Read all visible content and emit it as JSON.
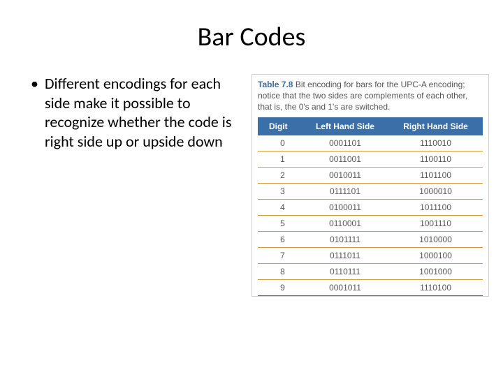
{
  "title": "Bar Codes",
  "bullet": "Different encodings for each side make it possible to recognize whether the code is right side up or upside down",
  "caption_label": "Table 7.8",
  "caption_text": "Bit encoding for bars for the UPC-A encoding; notice that the two sides are complements of each other, that is, the 0's and 1's are switched.",
  "chart_data": {
    "type": "table",
    "columns": [
      "Digit",
      "Left Hand Side",
      "Right Hand Side"
    ],
    "rows": [
      {
        "digit": "0",
        "left": "0001101",
        "right": "1110010"
      },
      {
        "digit": "1",
        "left": "0011001",
        "right": "1100110"
      },
      {
        "digit": "2",
        "left": "0010011",
        "right": "1101100"
      },
      {
        "digit": "3",
        "left": "0111101",
        "right": "1000010"
      },
      {
        "digit": "4",
        "left": "0100011",
        "right": "1011100"
      },
      {
        "digit": "5",
        "left": "0110001",
        "right": "1001110"
      },
      {
        "digit": "6",
        "left": "0101111",
        "right": "1010000"
      },
      {
        "digit": "7",
        "left": "0111011",
        "right": "1000100"
      },
      {
        "digit": "8",
        "left": "0110111",
        "right": "1001000"
      },
      {
        "digit": "9",
        "left": "0001011",
        "right": "1110100"
      }
    ]
  }
}
